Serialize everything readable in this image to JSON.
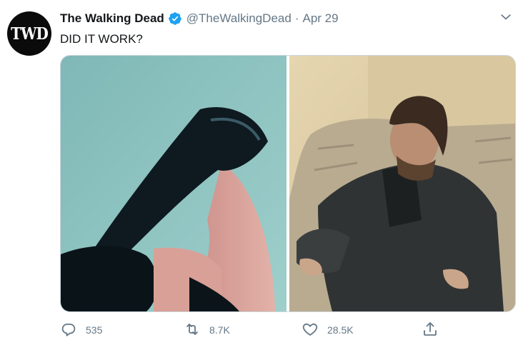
{
  "account": {
    "avatar_text": "TWD",
    "display_name": "The Walking Dead",
    "handle": "@TheWalkingDead",
    "separator": "·",
    "date": "Apr 29"
  },
  "tweet": {
    "text": "DID IT WORK?"
  },
  "icons": {
    "verified": "verified-badge-icon",
    "caret": "chevron-down-icon",
    "reply": "reply-icon",
    "retweet": "retweet-icon",
    "like": "heart-icon",
    "share": "share-icon"
  },
  "actions": {
    "replies": "535",
    "retweets": "8.7K",
    "likes": "28.5K"
  },
  "colors": {
    "verified": "#1da1f2",
    "secondary_text": "#657786",
    "primary_text": "#14171a"
  }
}
